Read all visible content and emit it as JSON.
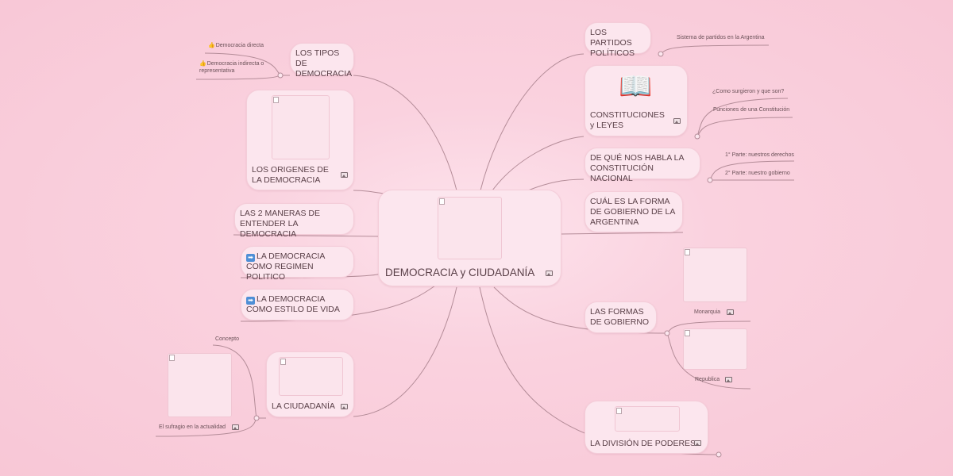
{
  "center": {
    "title": "DEMOCRACIA y CIUDADANÍA",
    "image_icon": "image-icon"
  },
  "left": {
    "tipos": {
      "label": "LOS TIPOS DE DEMOCRACIA",
      "children": [
        "Democracia directa",
        "Democracia indirecta o representativa"
      ],
      "child_icon": "thumbs-up-icon"
    },
    "origenes": {
      "label": "LOS ORIGENES DE LA DEMOCRACIA"
    },
    "maneras": {
      "label": "LAS 2 MANERAS DE ENTENDER LA DEMOCRACIA"
    },
    "regimen": {
      "label": "LA DEMOCRACIA COMO REGIMEN POLITICO",
      "icon": "arrow-right-icon"
    },
    "estilo": {
      "label": "LA DEMOCRACIA COMO ESTILO DE VIDA",
      "icon": "arrow-right-icon"
    },
    "ciudadania": {
      "label": "LA CIUDADANÍA",
      "children": [
        "Concepto",
        "El sufragio en la actualidad"
      ]
    }
  },
  "right": {
    "partidos": {
      "label": "LOS PARTIDOS POLÍTICOS",
      "children": [
        "Sistema de partidos en la Argentina"
      ]
    },
    "constituciones": {
      "label": "CONSTITUCIONES y LEYES",
      "icon": "book-icon",
      "children": [
        "¿Como surgieron y que son?",
        "Funciones de una Constitución"
      ]
    },
    "habla": {
      "label": "DE QUÉ NOS HABLA LA CONSTITUCIÓN NACIONAL",
      "children": [
        "1° Parte: nuestros derechos",
        "2° Parte: nuestro gobierno"
      ]
    },
    "forma": {
      "label": "CUÁL ES LA FORMA DE GOBIERNO DE LA ARGENTINA"
    },
    "formas": {
      "label": "LAS FORMAS DE GOBIERNO",
      "children": [
        "Monarquia",
        "Republica"
      ]
    },
    "division": {
      "label": "LA DIVISIÓN DE PODERES"
    }
  },
  "colors": {
    "background": "#f8c7d6",
    "node": "#fce6ee",
    "line": "#b48c98"
  }
}
